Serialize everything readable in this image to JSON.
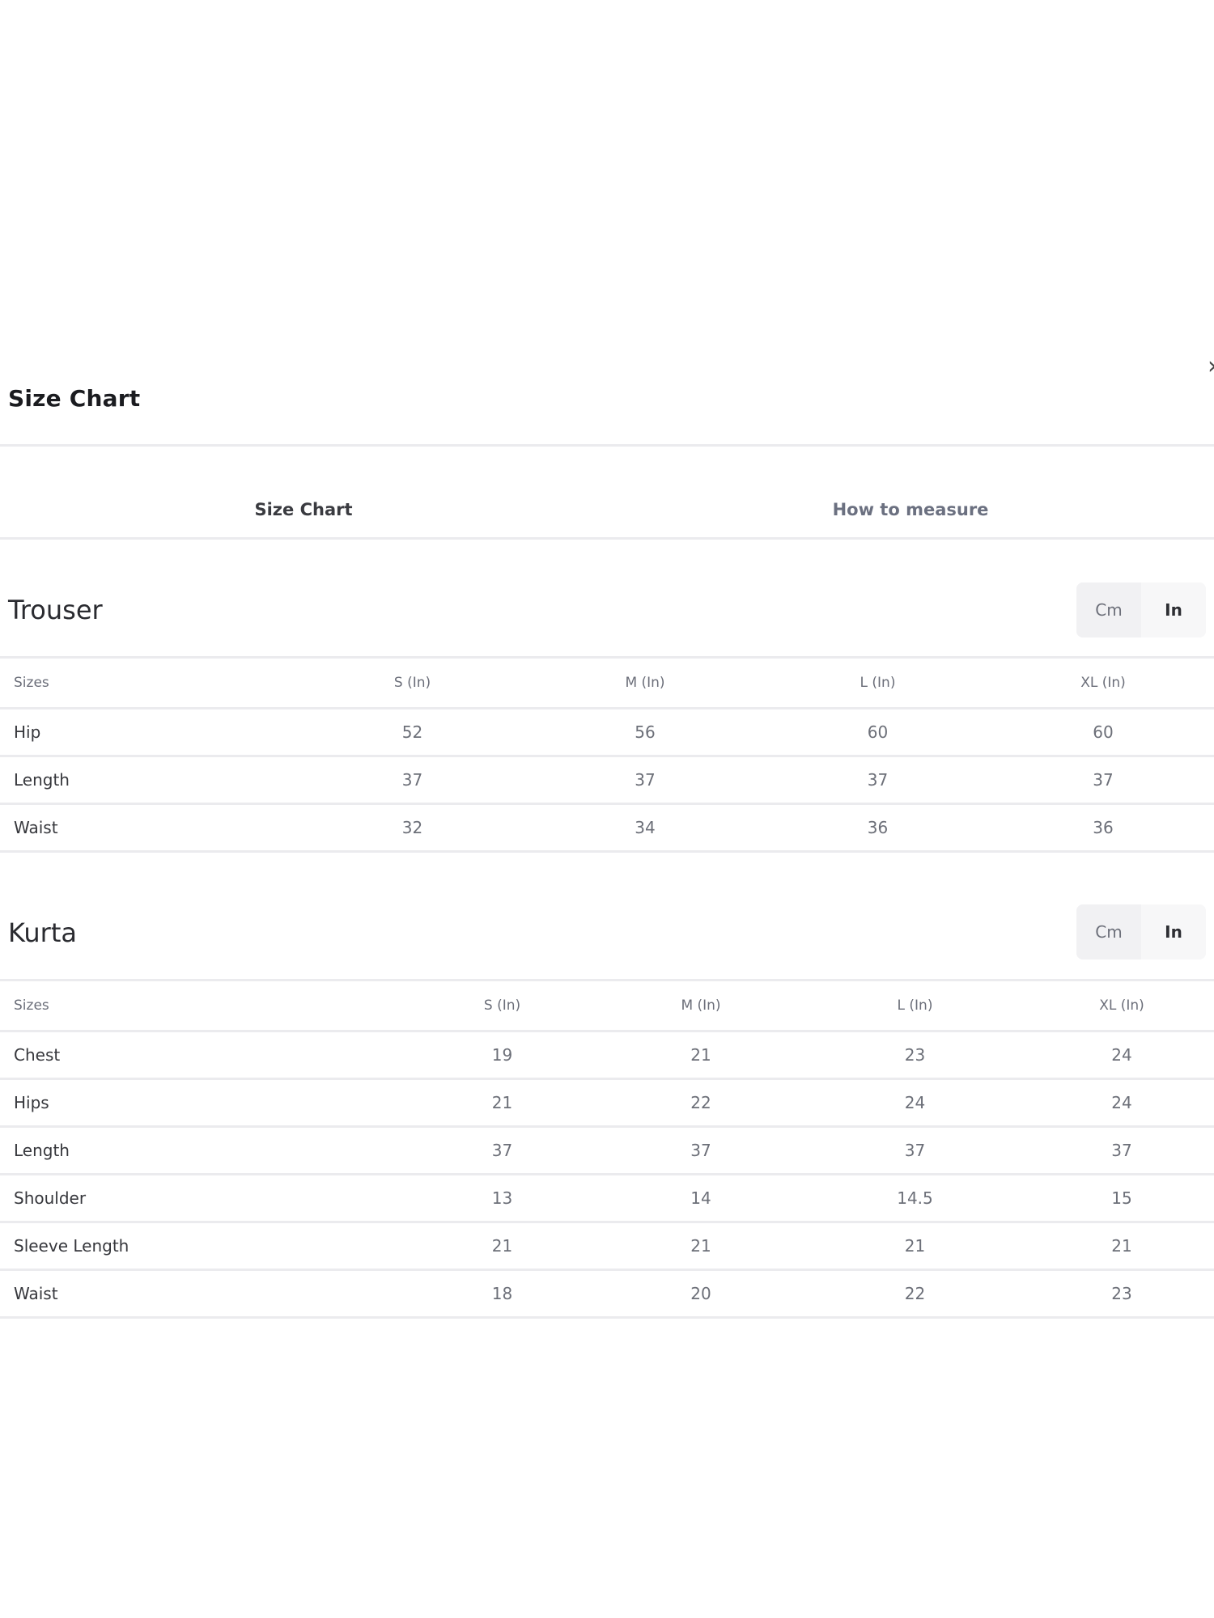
{
  "modal": {
    "title": "Size Chart",
    "close_icon": "close-icon"
  },
  "tabs": [
    {
      "label": "Size Chart",
      "active": true
    },
    {
      "label": "How to measure",
      "active": false
    }
  ],
  "unit_toggle": {
    "cm": "Cm",
    "in": "In",
    "selected": "In"
  },
  "trouser": {
    "title": "Trouser",
    "headers": [
      "Sizes",
      "S (In)",
      "M (In)",
      "L (In)",
      "XL (In)"
    ],
    "rows": [
      [
        "Hip",
        "52",
        "56",
        "60",
        "60"
      ],
      [
        "Length",
        "37",
        "37",
        "37",
        "37"
      ],
      [
        "Waist",
        "32",
        "34",
        "36",
        "36"
      ]
    ]
  },
  "kurta": {
    "title": "Kurta",
    "headers": [
      "Sizes",
      "S (In)",
      "M (In)",
      "L (In)",
      "XL (In)"
    ],
    "rows": [
      [
        "Chest",
        "19",
        "21",
        "23",
        "24"
      ],
      [
        "Hips",
        "21",
        "22",
        "24",
        "24"
      ],
      [
        "Length",
        "37",
        "37",
        "37",
        "37"
      ],
      [
        "Shoulder",
        "13",
        "14",
        "14.5",
        "15"
      ],
      [
        "Sleeve Length",
        "21",
        "21",
        "21",
        "21"
      ],
      [
        "Waist",
        "18",
        "20",
        "22",
        "23"
      ]
    ]
  }
}
